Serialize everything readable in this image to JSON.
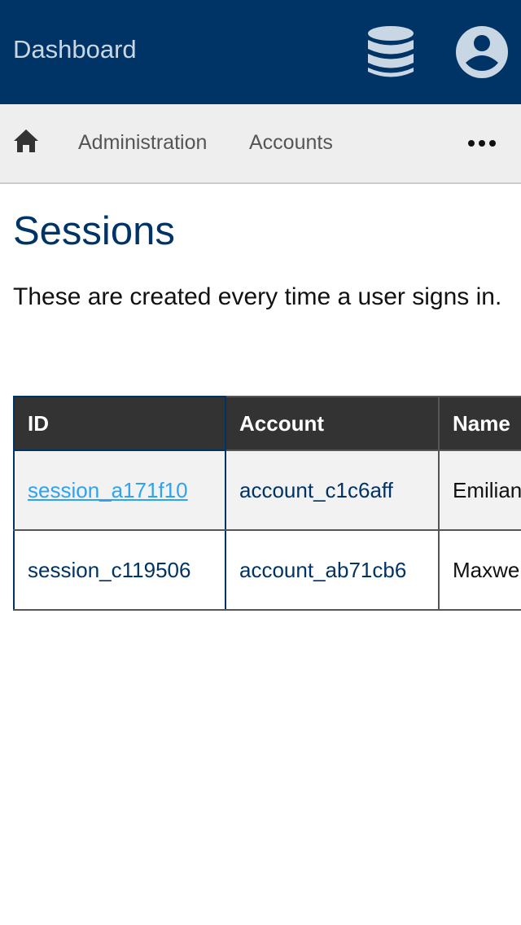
{
  "header": {
    "title": "Dashboard",
    "icons": [
      "database-icon",
      "account-circle-icon"
    ]
  },
  "nav": {
    "home_icon": "home-icon",
    "items": [
      {
        "label": "Administration"
      },
      {
        "label": "Accounts"
      }
    ],
    "more_icon": "more-horizontal-icon"
  },
  "page": {
    "title": "Sessions",
    "description": "These are created every time a user signs in."
  },
  "table": {
    "headers": [
      "ID",
      "Account",
      "Name"
    ],
    "rows": [
      {
        "id": "session_a171f10",
        "account": "account_c1c6aff",
        "name": "Emilian Harvey"
      },
      {
        "id": "session_c119506",
        "account": "account_ab71cb6",
        "name": "Maxwell Rau"
      }
    ]
  },
  "colors": {
    "primary": "#003366",
    "link": "#2ea3f2",
    "header_bg": "#333333",
    "nav_bg": "#eeeeee"
  }
}
